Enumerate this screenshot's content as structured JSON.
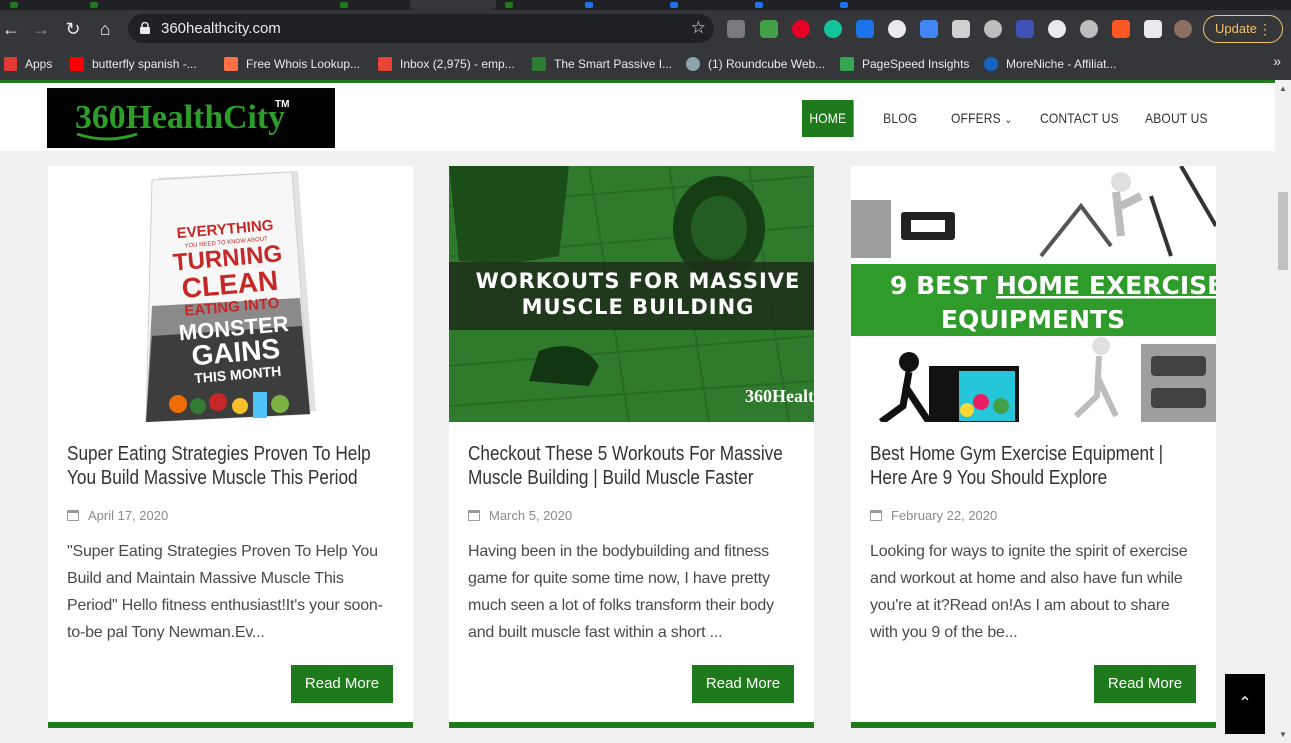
{
  "browser": {
    "url": "360healthcity.com",
    "update_label": "Update",
    "bookmarks": [
      {
        "label": "Apps",
        "icon": "apps-grid-icon"
      },
      {
        "label": "butterfly spanish -...",
        "icon": "youtube-icon"
      },
      {
        "label": "Free Whois Lookup...",
        "icon": "whois-icon"
      },
      {
        "label": "Inbox (2,975) - emp...",
        "icon": "gmail-icon"
      },
      {
        "label": "The Smart Passive I...",
        "icon": "spi-icon"
      },
      {
        "label": "(1) Roundcube Web...",
        "icon": "roundcube-icon"
      },
      {
        "label": "PageSpeed Insights",
        "icon": "pagespeed-icon"
      },
      {
        "label": "MoreNiche - Affiliat...",
        "icon": "moreniche-icon"
      }
    ]
  },
  "site": {
    "logo_text": "360HealthCity",
    "logo_tm": "TM",
    "nav": [
      {
        "label": "HOME",
        "active": true
      },
      {
        "label": "BLOG",
        "active": false
      },
      {
        "label": "OFFERS",
        "active": false
      },
      {
        "label": "CONTACT US",
        "active": false
      },
      {
        "label": "ABOUT US",
        "active": false
      }
    ]
  },
  "posts": [
    {
      "title": "Super Eating Strategies Proven To Help You Build Massive Muscle This Period",
      "date": "April 17, 2020",
      "excerpt": "   \"Super Eating Strategies Proven To Help You Build and Maintain Massive Muscle This Period\"  Hello fitness enthusiast!It's your soon-to-be pal Tony Newman.Ev...",
      "read_more": "Read More",
      "image": {
        "line1": "EVERYTHING",
        "line2": "YOU NEED TO KNOW ABOUT",
        "line3": "TURNING",
        "line4": "CLEAN",
        "line5": "EATING INTO",
        "line6": "MONSTER",
        "line7": "GAINS",
        "line8": "THIS MONTH"
      }
    },
    {
      "title": "Checkout These 5 Workouts For Massive Muscle Building | Build Muscle Faster",
      "date": "March 5, 2020",
      "excerpt": " Having been in the bodybuilding and fitness game for quite some time now, I have pretty much seen a lot of folks transform their body and built muscle fast within a short ...",
      "read_more": "Read More",
      "image": {
        "line1": "WORKOUTS  FOR MASSIVE",
        "line2": "MUSCLE BUILDING",
        "watermark": "360Healt"
      }
    },
    {
      "title": "Best Home Gym Exercise Equipment | Here Are 9 You Should Explore",
      "date": "February 22, 2020",
      "excerpt": " Looking for ways to ignite the spirit of exercise and workout at home and also have fun while you're at it?Read on!As I am about to share with you 9 of the be...",
      "read_more": "Read More",
      "image": {
        "line1_a": "9 BEST ",
        "line1_b": "HOME EXERCISE",
        "line2": "EQUIPMENTS"
      }
    }
  ],
  "colors": {
    "brand_green": "#1e7a1b",
    "chrome_dark": "#35363a"
  }
}
